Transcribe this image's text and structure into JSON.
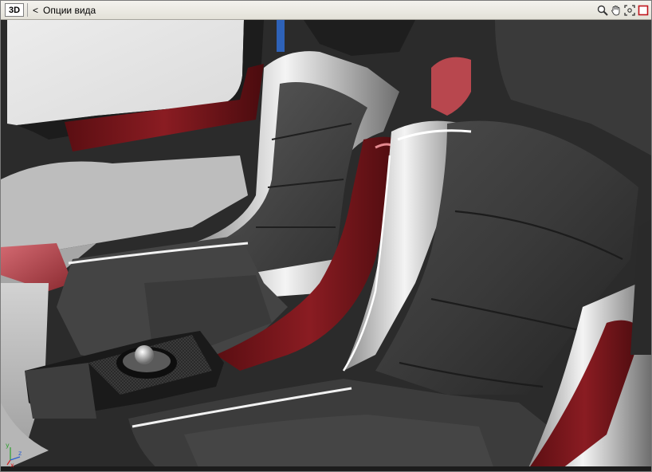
{
  "toolbar": {
    "mode_label": "3D",
    "back_symbol": "<",
    "title": "Опции вида",
    "tools": [
      "zoom-icon",
      "pan-hand-icon",
      "fit-view-icon",
      "maximize-icon"
    ]
  },
  "axes": {
    "y_label": "y",
    "z_label": "z",
    "x_label": "x"
  },
  "colors": {
    "accent_red": "#8a1c22",
    "upholstery": "#3c3c3c",
    "trim_silver": "#cfcfcf"
  }
}
